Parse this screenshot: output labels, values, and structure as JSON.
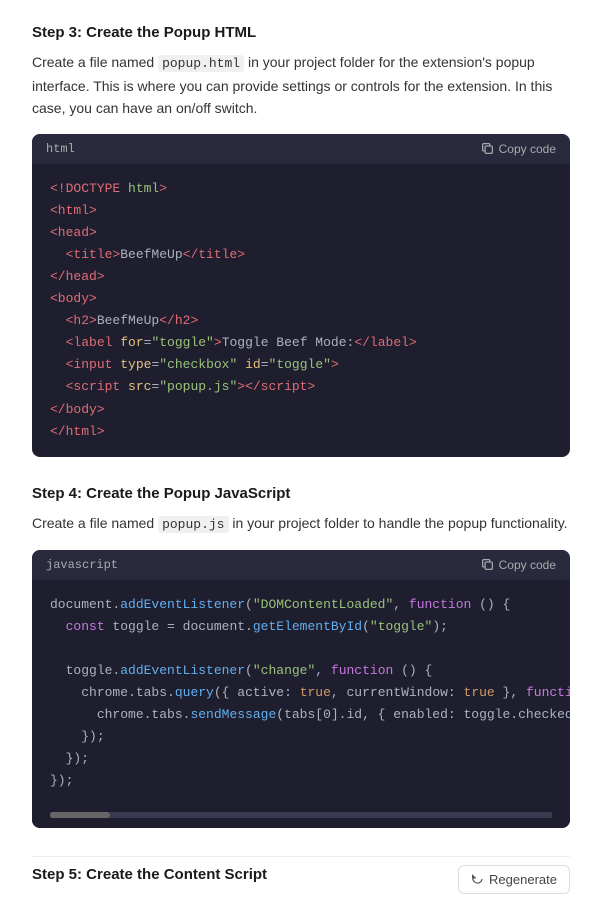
{
  "step3": {
    "heading": "Step 3: Create the Popup HTML",
    "description_parts": [
      "Create a file named ",
      "popup.html",
      " in your project folder for the extension's popup interface. This is where you can provide settings or controls for the extension. In this case, you can have an on/off switch."
    ],
    "code_lang": "html",
    "copy_label": "Copy code"
  },
  "step4": {
    "heading": "Step 4: Create the Popup JavaScript",
    "description_parts": [
      "Create a file named ",
      "popup.js",
      " in your project folder to handle the popup functionality."
    ],
    "code_lang": "javascript",
    "copy_label": "Copy code"
  },
  "step5": {
    "heading": "Step 5: Create the Content Script"
  },
  "footer": {
    "regenerate_label": "Regenerate"
  }
}
